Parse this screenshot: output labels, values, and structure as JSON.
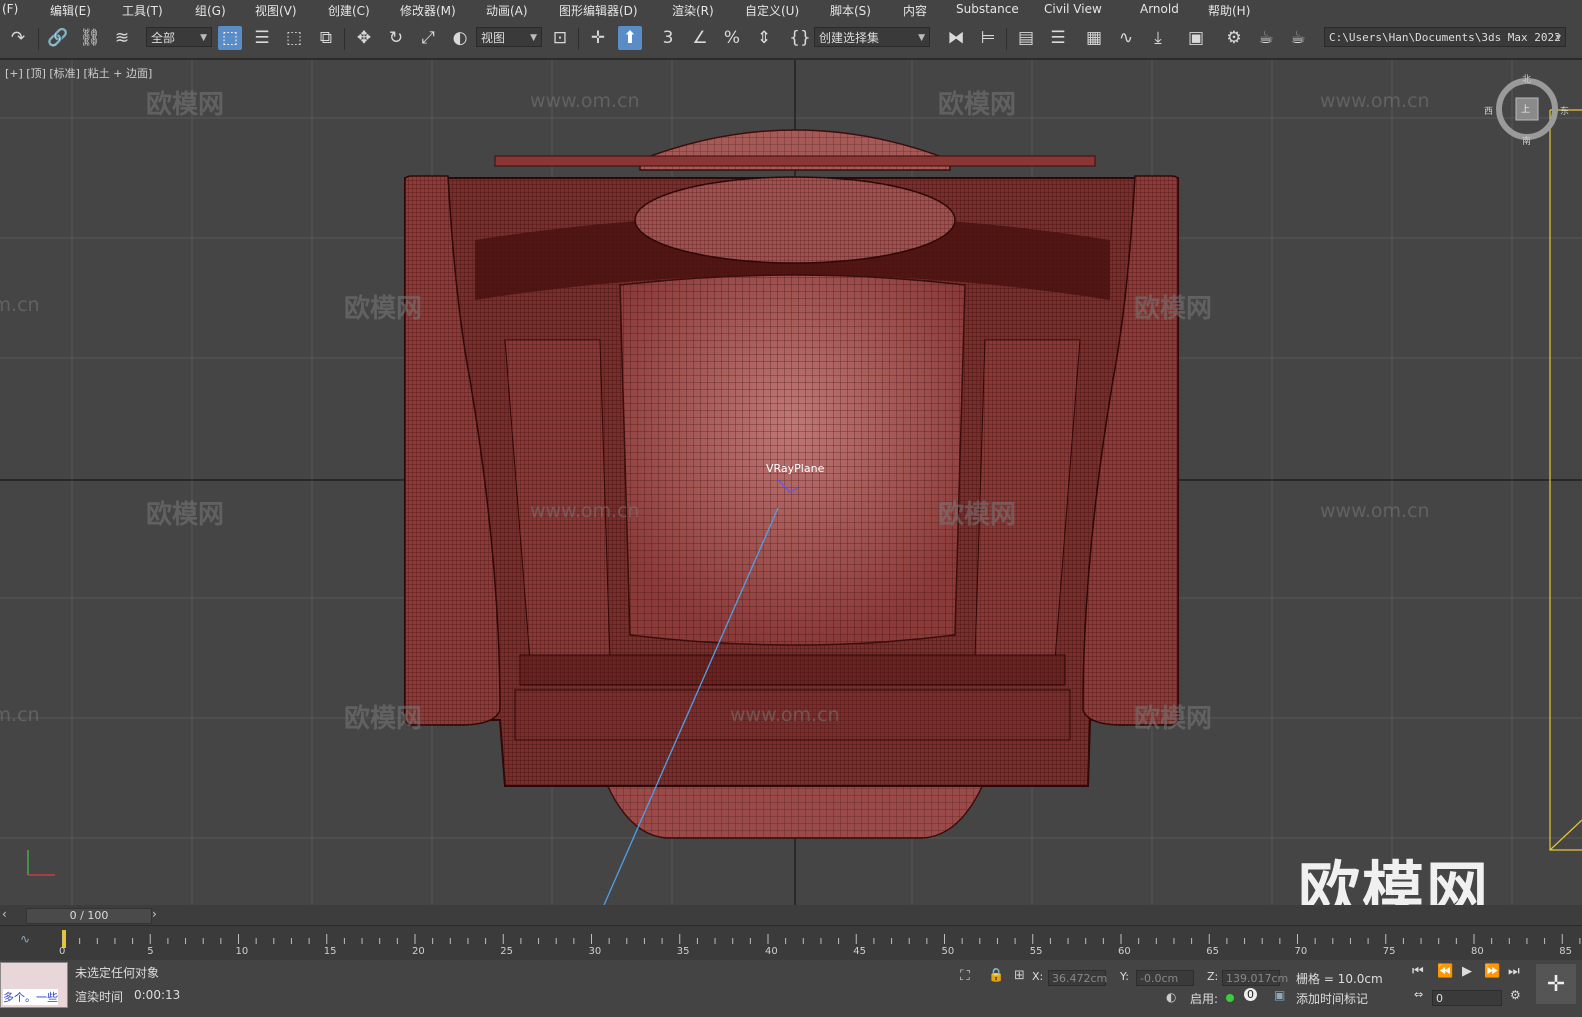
{
  "menu": [
    "(F)",
    "编辑(E)",
    "工具(T)",
    "组(G)",
    "视图(V)",
    "创建(C)",
    "修改器(M)",
    "动画(A)",
    "图形编辑器(D)",
    "渲染(R)",
    "自定义(U)",
    "脚本(S)",
    "内容",
    "Substance",
    "Civil View",
    "Arnold",
    "帮助(H)"
  ],
  "toolbar": {
    "filter_value": "全部",
    "refcoord_value": "视图",
    "selection_set_value": "创建选择集",
    "project_path": "C:\\Users\\Han\\Documents\\3ds Max 2022",
    "icons": [
      "redo-icon",
      "link-icon",
      "unlink-icon",
      "bind-spacewarp-icon",
      "select-object-icon",
      "select-by-name-icon",
      "rect-selection-icon",
      "window-crossing-icon",
      "move-icon",
      "rotate-icon",
      "scale-icon",
      "placement-icon",
      "use-pivot-icon",
      "snap-3d-icon",
      "angle-snap-icon",
      "percent-snap-icon",
      "spinner-snap-icon",
      "mirror-icon",
      "align-icon",
      "layer-explorer-icon",
      "scene-explorer-icon",
      "ribbon-icon",
      "curve-editor-icon",
      "schematic-icon",
      "material-editor-icon",
      "render-setup-icon",
      "render-frame-icon",
      "render-icon"
    ]
  },
  "viewport": {
    "label": "[+] [顶] [标准] [粘土 + 边面]",
    "object_label": "VRayPlane",
    "watermark_text": "欧模网",
    "watermark_url": "www.om.cn",
    "big_watermark": "欧模网",
    "viewcube": {
      "north": "北",
      "south": "南",
      "west": "西",
      "east": "东",
      "face": "上"
    },
    "colors": {
      "background": "#454545",
      "grid": "#575757",
      "axis": "#1e1e1e",
      "mesh_fill": "#7a2e2c",
      "mesh_wire": "#3a0e0c",
      "highlight": "#c47a78",
      "light_line": "#4ea0e8",
      "selection": "#e6c530"
    }
  },
  "timeline": {
    "slider_label": "0 / 100",
    "ticks": [
      "0",
      "5",
      "10",
      "15",
      "20",
      "25",
      "30",
      "35",
      "40",
      "45",
      "50",
      "55",
      "60",
      "65",
      "70",
      "75",
      "80",
      "85"
    ]
  },
  "status": {
    "thumb_text": "多个。一些",
    "selection_message": "未选定任何对象",
    "render_time_label": "渲染时间",
    "render_time_value": "0:00:13",
    "x_label": "X:",
    "x_value": "36.472cm",
    "y_label": "Y:",
    "y_value": "-0.0cm",
    "z_label": "Z:",
    "z_value": "139.017cm",
    "grid_text": "栅格 = 10.0cm",
    "enable_label": "启用:",
    "enable_value": "0",
    "add_time_tag": "添加时间标记",
    "frame_value": "0"
  }
}
